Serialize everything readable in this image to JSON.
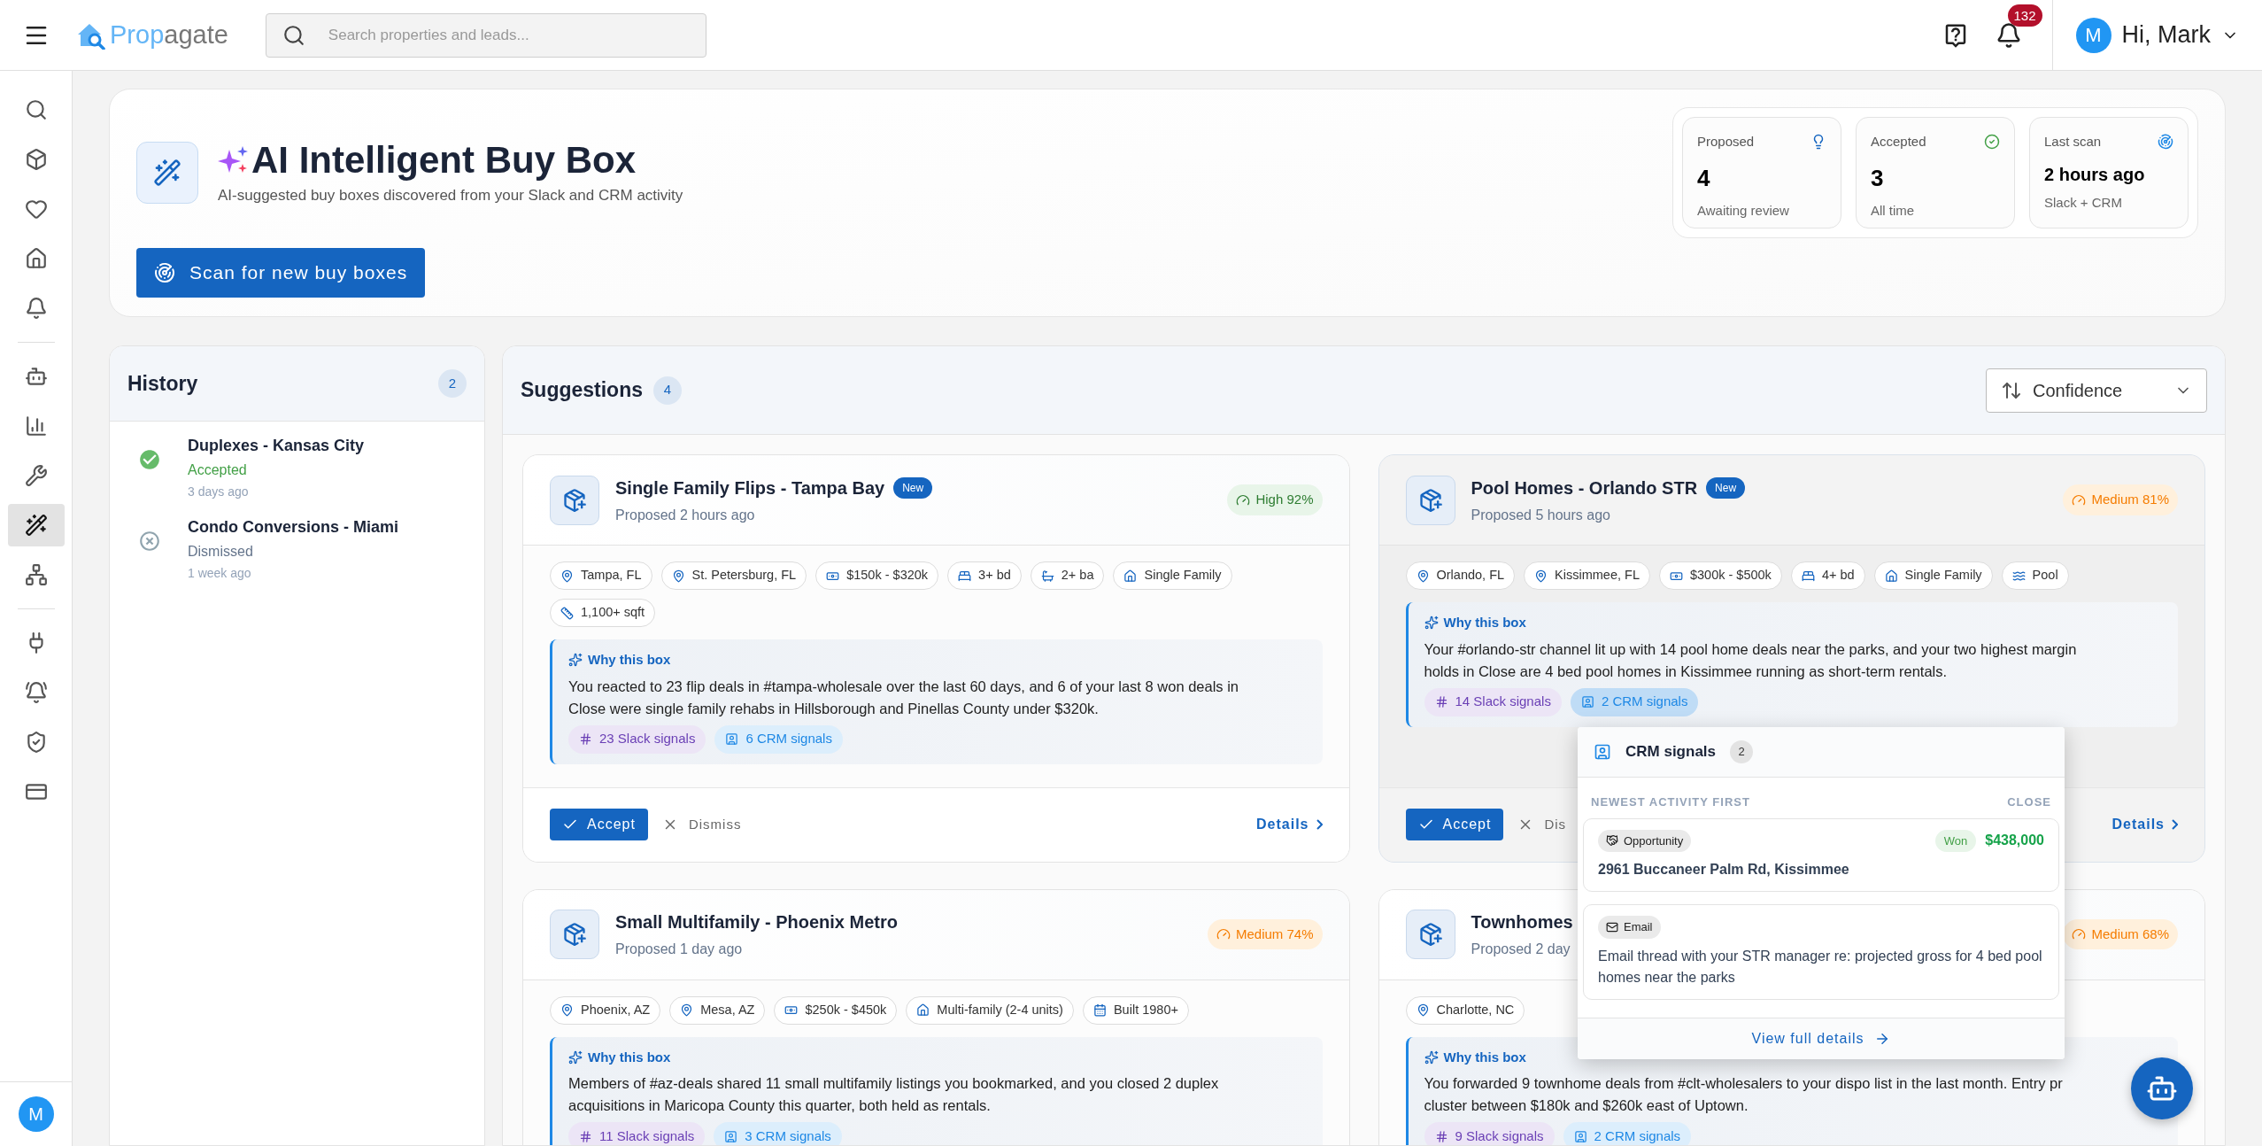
{
  "topbar": {
    "logo_text": [
      "Prop",
      "agate"
    ],
    "search": {
      "placeholder": "Search properties and leads..."
    },
    "notifications": {
      "count": "132"
    },
    "user": {
      "initial": "M",
      "greeting": "Hi, Mark"
    }
  },
  "sidebar": {
    "items": [
      {
        "kind": "search",
        "selected": false
      },
      {
        "kind": "box",
        "selected": false
      },
      {
        "kind": "heart",
        "selected": false
      },
      {
        "kind": "house",
        "selected": false
      },
      {
        "kind": "bell",
        "selected": false
      },
      {
        "kind": "divider"
      },
      {
        "kind": "robot",
        "selected": false
      },
      {
        "kind": "chart",
        "selected": false
      },
      {
        "kind": "tools",
        "selected": false
      },
      {
        "kind": "wand",
        "selected": true
      },
      {
        "kind": "sitemap",
        "selected": false
      },
      {
        "kind": "divider"
      },
      {
        "kind": "plug",
        "selected": false
      },
      {
        "kind": "bell_gear",
        "selected": false
      },
      {
        "kind": "shield",
        "selected": false
      },
      {
        "kind": "card",
        "selected": false
      }
    ],
    "avatar": "M"
  },
  "header": {
    "title": "AI Intelligent Buy Box",
    "subtitle": "AI-suggested buy boxes discovered from your Slack and CRM activity",
    "scan_button": "Scan for new buy boxes",
    "stats": [
      {
        "kind": "proposed",
        "label": "Proposed",
        "value": "4",
        "note": "Awaiting review"
      },
      {
        "kind": "accepted",
        "label": "Accepted",
        "value": "3",
        "note": "All time"
      },
      {
        "kind": "scan",
        "label": "Last scan",
        "value": "2 hours ago",
        "note": "Slack + CRM"
      }
    ]
  },
  "history": {
    "title": "History",
    "count": "2",
    "items": [
      {
        "name": "Duplexes - Kansas City",
        "kind": "accepted",
        "status_label": "Accepted",
        "time": "3 days ago"
      },
      {
        "name": "Condo Conversions - Miami",
        "kind": "dismissed",
        "status_label": "Dismissed",
        "time": "1 week ago"
      }
    ]
  },
  "suggestions": {
    "title": "Suggestions",
    "count": "4",
    "sort": {
      "label": "Confidence"
    },
    "cards": [
      {
        "title": "Single Family Flips - Tampa Bay",
        "new": true,
        "new_label": "New",
        "proposed": "Proposed 2 hours ago",
        "highlighted": false,
        "confidence": {
          "kind": "high",
          "label": "High 92%"
        },
        "chips": [
          {
            "kind": "location",
            "label": "Tampa, FL"
          },
          {
            "kind": "location",
            "label": "St. Petersburg, FL"
          },
          {
            "kind": "price",
            "label": "$150k - $320k"
          },
          {
            "kind": "beds",
            "label": "3+ bd"
          },
          {
            "kind": "baths",
            "label": "2+ ba"
          },
          {
            "kind": "type",
            "label": "Single Family"
          },
          {
            "kind": "sqft",
            "label": "1,100+ sqft"
          }
        ],
        "why_label": "Why this box",
        "reason_lines": [
          "You reacted to 23 flip deals in #tampa-wholesale over the last 60 days, and 6 of your last 8 won deals in",
          "Close were single family rehabs in Hillsborough and Pinellas County under $320k."
        ],
        "signals": [
          {
            "kind": "slack",
            "label": "23 Slack signals",
            "selected": false
          },
          {
            "kind": "crm",
            "label": "6 CRM signals",
            "selected": false
          }
        ],
        "actions": {
          "accept": "Accept",
          "dismiss": "Dismiss",
          "details": "Details"
        }
      },
      {
        "title": "Pool Homes - Orlando STR",
        "new": true,
        "new_label": "New",
        "proposed": "Proposed 5 hours ago",
        "highlighted": true,
        "confidence": {
          "kind": "medium",
          "label": "Medium 81%"
        },
        "chips": [
          {
            "kind": "location",
            "label": "Orlando, FL"
          },
          {
            "kind": "location",
            "label": "Kissimmee, FL"
          },
          {
            "kind": "price",
            "label": "$300k - $500k"
          },
          {
            "kind": "beds",
            "label": "4+ bd"
          },
          {
            "kind": "type",
            "label": "Single Family"
          },
          {
            "kind": "pool",
            "label": "Pool"
          }
        ],
        "why_label": "Why this box",
        "reason_lines": [
          "Your #orlando-str channel lit up with 14 pool home deals near the parks, and your two highest margin",
          "holds in Close are 4 bed pool homes in Kissimmee running as short-term rentals."
        ],
        "signals": [
          {
            "kind": "slack",
            "label": "14 Slack signals",
            "selected": false
          },
          {
            "kind": "crm",
            "label": "2 CRM signals",
            "selected": true
          }
        ],
        "actions": {
          "accept": "Accept",
          "dismiss": "Dis",
          "details": "Details"
        }
      },
      {
        "title": "Small Multifamily - Phoenix Metro",
        "new": false,
        "proposed": "Proposed 1 day ago",
        "highlighted": false,
        "confidence": {
          "kind": "medium",
          "label": "Medium 74%"
        },
        "chips": [
          {
            "kind": "location",
            "label": "Phoenix, AZ"
          },
          {
            "kind": "location",
            "label": "Mesa, AZ"
          },
          {
            "kind": "price",
            "label": "$250k - $450k"
          },
          {
            "kind": "type",
            "label": "Multi-family (2-4 units)"
          },
          {
            "kind": "built",
            "label": "Built 1980+"
          }
        ],
        "why_label": "Why this box",
        "reason_lines": [
          "Members of #az-deals shared 11 small multifamily listings you bookmarked, and you closed 2 duplex",
          "acquisitions in Maricopa County this quarter, both held as rentals."
        ],
        "signals": [
          {
            "kind": "slack",
            "label": "11 Slack signals",
            "selected": false
          },
          {
            "kind": "crm",
            "label": "3 CRM signals",
            "selected": false
          }
        ]
      },
      {
        "title": "Townhomes",
        "new": false,
        "proposed": "Proposed 2 day",
        "highlighted": false,
        "confidence": {
          "kind": "medium",
          "label": "Medium 68%"
        },
        "chips": [
          {
            "kind": "location",
            "label": "Charlotte, NC"
          }
        ],
        "why_label": "Why this box",
        "reason_lines": [
          "You forwarded 9 townhome deals from #clt-wholesalers to your dispo list in the last month. Entry pr",
          "cluster between $180k and $260k east of Uptown."
        ],
        "signals": [
          {
            "kind": "slack",
            "label": "9 Slack signals",
            "selected": false
          },
          {
            "kind": "crm",
            "label": "2 CRM signals",
            "selected": false
          }
        ]
      }
    ]
  },
  "popover": {
    "title": "CRM signals",
    "count": "2",
    "sort_note": "NEWEST ACTIVITY FIRST",
    "close": "CLOSE",
    "items": [
      {
        "kind": "opportunity",
        "tag": "Opportunity",
        "status": "Won",
        "amount": "$438,000",
        "text": "2961 Buccaneer Palm Rd, Kissimmee"
      },
      {
        "kind": "email",
        "tag": "Email",
        "text": "Email thread with your STR manager re: projected gross for 4 bed pool homes near the parks"
      }
    ],
    "link": "View full details"
  }
}
